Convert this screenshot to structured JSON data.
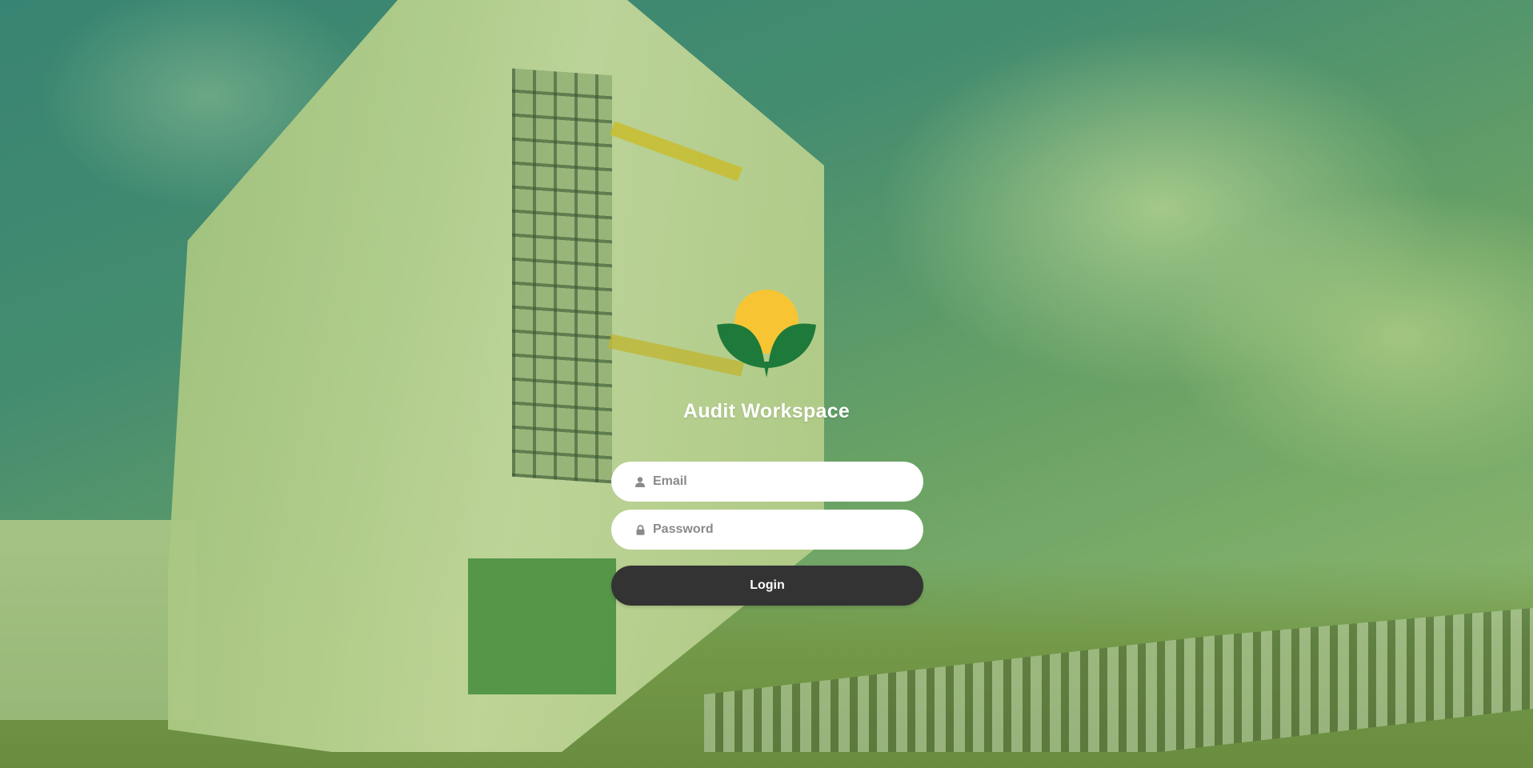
{
  "app": {
    "title": "Audit Workspace"
  },
  "login_form": {
    "email": {
      "placeholder": "Email",
      "value": "",
      "icon": "user-icon"
    },
    "password": {
      "placeholder": "Password",
      "value": "",
      "icon": "lock-icon"
    },
    "submit_label": "Login"
  },
  "colors": {
    "logo_sun": "#F7C534",
    "logo_leaves": "#1E7A3A",
    "button_bg": "#333333",
    "title_text": "#FFFFFF"
  }
}
